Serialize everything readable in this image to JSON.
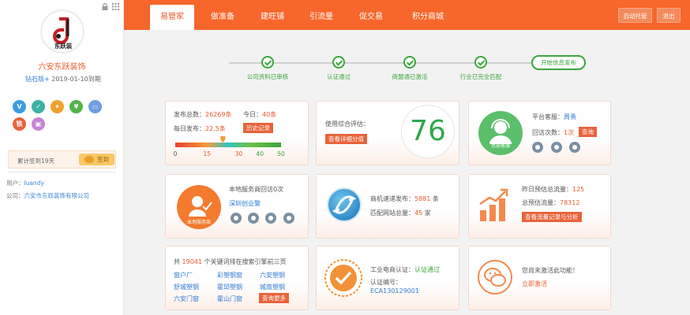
{
  "sidebar": {
    "shop_name": "六安东跃装饰",
    "logo_text": "东跃装",
    "level": "钻石版+",
    "expiry": "2019-01-10到期",
    "badges": [
      {
        "icon": "v-verified-icon",
        "glyph": "V",
        "color": "#3a9be0"
      },
      {
        "icon": "shield-icon",
        "glyph": "✓",
        "color": "#3bb3a4"
      },
      {
        "icon": "medal-icon",
        "glyph": "✦",
        "color": "#f0a12d"
      },
      {
        "icon": "yuan-icon",
        "glyph": "¥",
        "color": "#54b24a"
      },
      {
        "icon": "card-icon",
        "glyph": "▭",
        "color": "#6f9de0"
      },
      {
        "icon": "iron-icon",
        "glyph": "铁",
        "color": "#e8633a"
      },
      {
        "icon": "image-icon",
        "glyph": "▣",
        "color": "#c983d6"
      }
    ],
    "sign_text": "累计签到19天",
    "sign_button": "签到",
    "user_label": "用户：",
    "user_value": "luandy",
    "company_label": "公司：",
    "company_value": "六安市东跃装饰有限公司"
  },
  "nav": {
    "tabs": [
      "易管家",
      "做准备",
      "建旺铺",
      "引流量",
      "促交易",
      "积分商城"
    ],
    "active_tab": 0,
    "auto_btn": "自动托管",
    "logout_btn": "退出"
  },
  "steps": {
    "items": [
      "公司资料已审核",
      "认证通过",
      "商盟通已激活",
      "行业已完全匹配"
    ],
    "final": "开始信息发布",
    "color": "#3aa63a"
  },
  "card_publish": {
    "total_label": "发布总数：",
    "total_value": "26269条",
    "today_label": "今日：",
    "today_value": "40条",
    "daily_label": "每日发布：",
    "daily_value": "22.5条",
    "history_btn": "历史记录",
    "gauge_ticks": [
      "0",
      "15",
      "30",
      "40",
      "50"
    ],
    "gauge_value": 22.5,
    "gauge_max": 50
  },
  "card_score": {
    "label": "使用综合评估：",
    "button": "查看详细分值",
    "score": "76"
  },
  "card_service": {
    "platform_label": "平台客服：",
    "platform_value": "周勇",
    "visits_label": "回访次数：",
    "visits_value": "1次",
    "query_btn": "查询",
    "avatar_text": "总部客服"
  },
  "card_local": {
    "visit_text": "本地服务商回访0次",
    "service_name": "深圳创业警",
    "avatar_text": "本地服务商"
  },
  "card_machine": {
    "speed_label": "商机速递发布：",
    "speed_value": "5881",
    "speed_unit": "条",
    "match_label": "匹配网站总量：",
    "match_value": "45",
    "match_unit": "家"
  },
  "card_traffic": {
    "yest_label": "昨日预估总流量：",
    "yest_value": "125",
    "total_label": "总预估流量：",
    "total_value": "78312",
    "button": "查看流量记录与分析"
  },
  "card_keywords": {
    "pre": "共",
    "count": "19041",
    "post": "个关键词排在搜索引擎前三页",
    "words": [
      "窗户厂",
      "彩塑钢窗",
      "六安塑钢",
      "舒城塑钢",
      "霍邱塑钢",
      "城南塑钢",
      "六安门窗",
      "霍山门窗"
    ],
    "more_btn": "查询更多"
  },
  "card_cert": {
    "cert_label": "工业电商认证：",
    "cert_value": "认证通过",
    "code_label": "认证编号：",
    "code_value": "ECA130129001"
  },
  "card_wechat": {
    "text": "您尚未激活此功能！",
    "link": "立即激活"
  }
}
